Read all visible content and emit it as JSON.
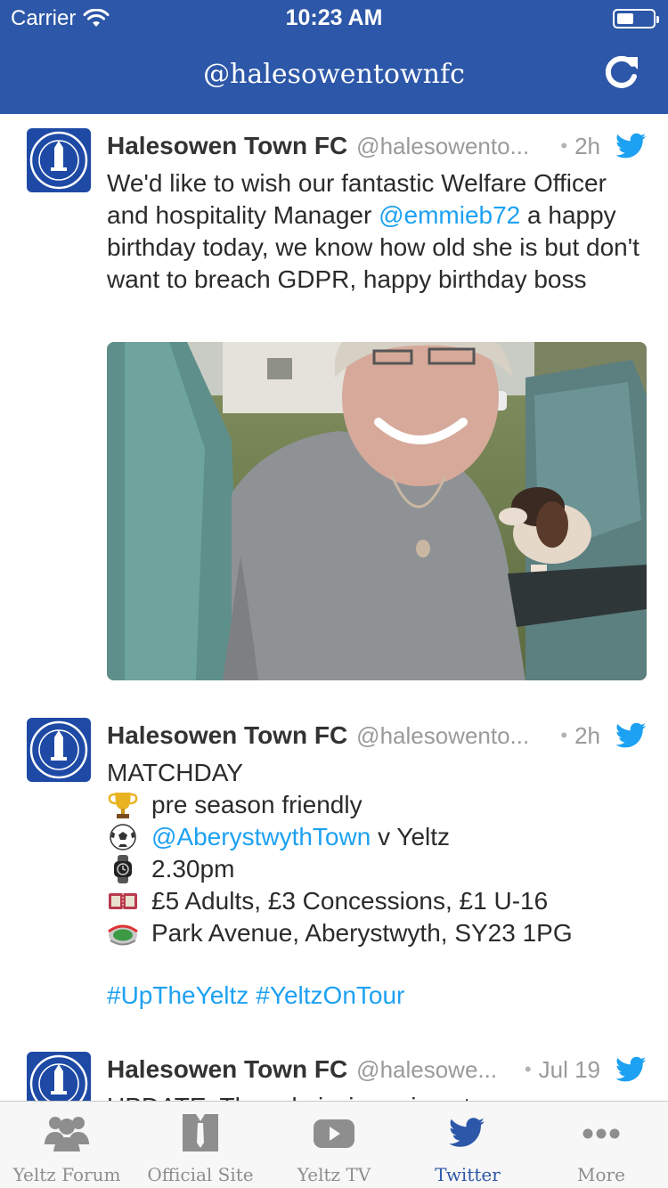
{
  "status_bar": {
    "carrier": "Carrier",
    "time": "10:23 AM"
  },
  "nav": {
    "title": "@halesowentownfc",
    "refresh_icon": "refresh-icon"
  },
  "colors": {
    "brand": "#2d57a8",
    "link": "#1da1f2",
    "tab_active": "#2d57a8",
    "tab_inactive": "#8e8e8e"
  },
  "tweets": [
    {
      "name": "Halesowen Town FC",
      "handle": "@halesowento...",
      "dot": "•",
      "time": "2h",
      "text": {
        "p1": "We'd like to wish our fantastic Welfare Officer and hospitality Manager ",
        "mention": "@emmieb72",
        "p2": " a happy birthday today, we know how old she is but don't want to breach GDPR, happy birthday boss"
      },
      "has_photo": true
    },
    {
      "name": "Halesowen Town FC",
      "handle": "@halesowento...",
      "dot": "•",
      "time": "2h",
      "lines": {
        "l0": "MATCHDAY",
        "l1": "pre season friendly",
        "l2_mention": "@AberystwythTown",
        "l2_rest": " v Yeltz",
        "l3": "2.30pm",
        "l4": "£5 Adults, £3 Concessions, £1 U-16",
        "l5": "Park Avenue, Aberystwyth, SY23 1PG"
      },
      "hashtags": {
        "h1": "#UpTheYeltz",
        "h2": "#YeltzOnTour"
      },
      "emoji_icons": [
        "trophy-icon",
        "soccer-ball-icon",
        "watch-icon",
        "ticket-icon",
        "stadium-icon"
      ]
    },
    {
      "name": "Halesowen Town FC",
      "handle": "@halesowe...",
      "dot": "•",
      "time": "Jul 19",
      "text_partial": "UPDATE: The admission price at"
    }
  ],
  "tabs": [
    {
      "label": "Yeltz Forum",
      "icon": "people-icon",
      "active": false
    },
    {
      "label": "Official Site",
      "icon": "kit-icon",
      "active": false
    },
    {
      "label": "Yeltz TV",
      "icon": "play-icon",
      "active": false
    },
    {
      "label": "Twitter",
      "icon": "twitter-bird-icon",
      "active": true
    },
    {
      "label": "More",
      "icon": "more-dots-icon",
      "active": false
    }
  ]
}
